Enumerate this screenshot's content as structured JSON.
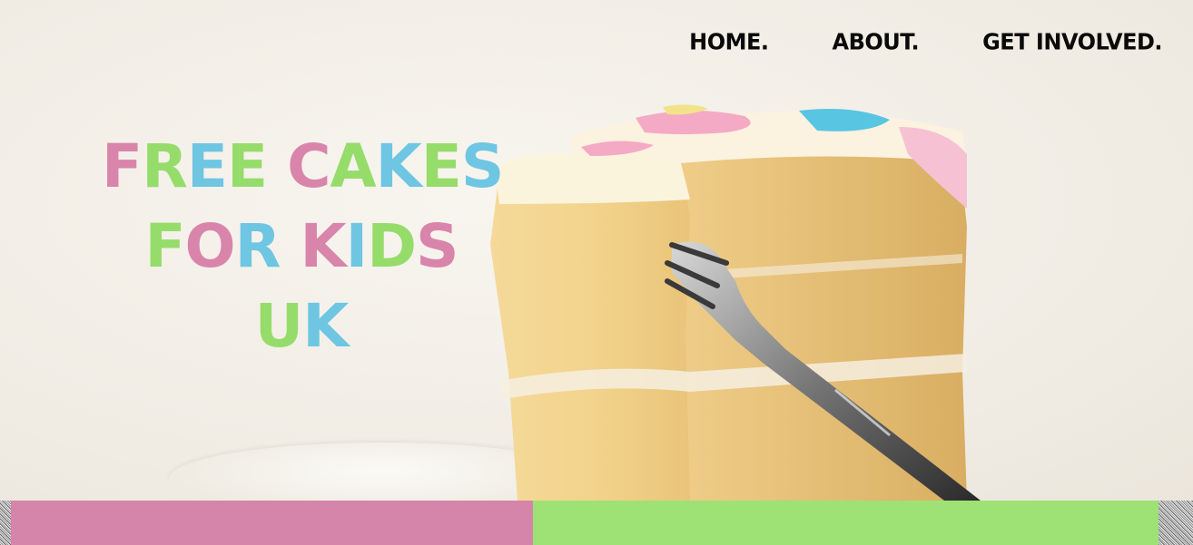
{
  "nav": {
    "items": [
      "HOME.",
      "ABOUT.",
      "GET INVOLVED."
    ]
  },
  "hero": {
    "title_lines": [
      "FREE CAKES",
      "FOR KIDS",
      "UK"
    ],
    "letter_colors": {
      "pink": "#d985ab",
      "green": "#96dc6a",
      "blue": "#6ec6e3"
    }
  },
  "footer_bar": {
    "left_color": "#d485a9",
    "right_color": "#9ee275"
  }
}
